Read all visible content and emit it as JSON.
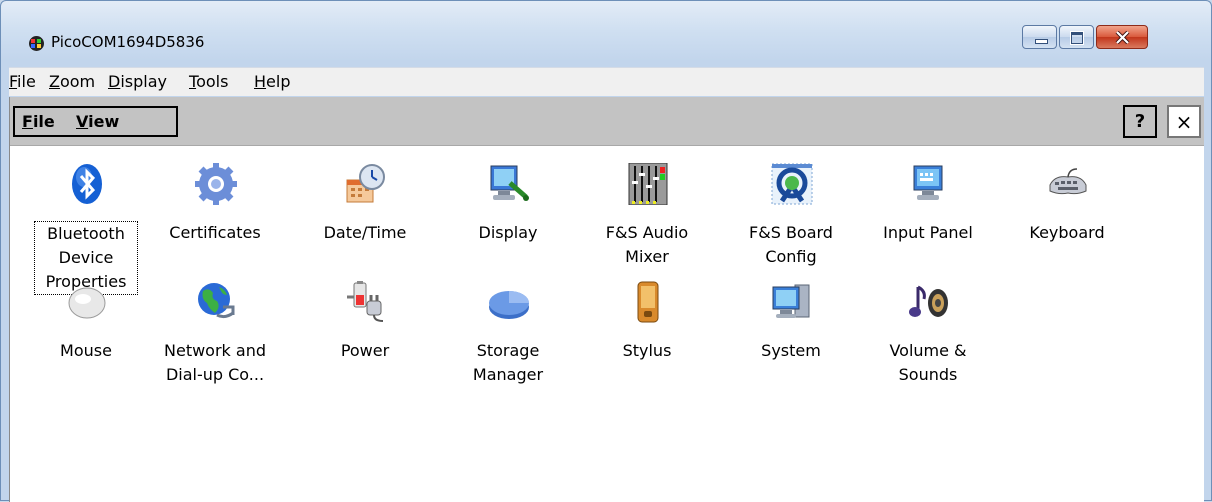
{
  "window": {
    "title": "PicoCOM1694D5836"
  },
  "menubar": {
    "items": [
      "File",
      "Zoom",
      "Display",
      "Tools",
      "Help"
    ]
  },
  "commandbar": {
    "items": [
      "File",
      "View"
    ],
    "help": "?",
    "close": "×"
  },
  "applets": [
    {
      "label": "Bluetooth Device Properties",
      "icon": "bluetooth-icon",
      "selected": true
    },
    {
      "label": "Certificates",
      "icon": "certificates-icon"
    },
    {
      "label": "Date/Time",
      "icon": "date-time-icon"
    },
    {
      "label": "Display",
      "icon": "display-icon"
    },
    {
      "label": "F&S Audio Mixer",
      "icon": "audio-mixer-icon"
    },
    {
      "label": "F&S Board Config",
      "icon": "board-config-icon"
    },
    {
      "label": "Input Panel",
      "icon": "input-panel-icon"
    },
    {
      "label": "Keyboard",
      "icon": "keyboard-icon"
    },
    {
      "label": "Mouse",
      "icon": "mouse-icon"
    },
    {
      "label": "Network and Dial-up Co...",
      "icon": "network-icon"
    },
    {
      "label": "Power",
      "icon": "power-icon"
    },
    {
      "label": "Storage Manager",
      "icon": "storage-manager-icon"
    },
    {
      "label": "Stylus",
      "icon": "stylus-icon"
    },
    {
      "label": "System",
      "icon": "system-icon"
    },
    {
      "label": "Volume & Sounds",
      "icon": "volume-sounds-icon"
    }
  ]
}
